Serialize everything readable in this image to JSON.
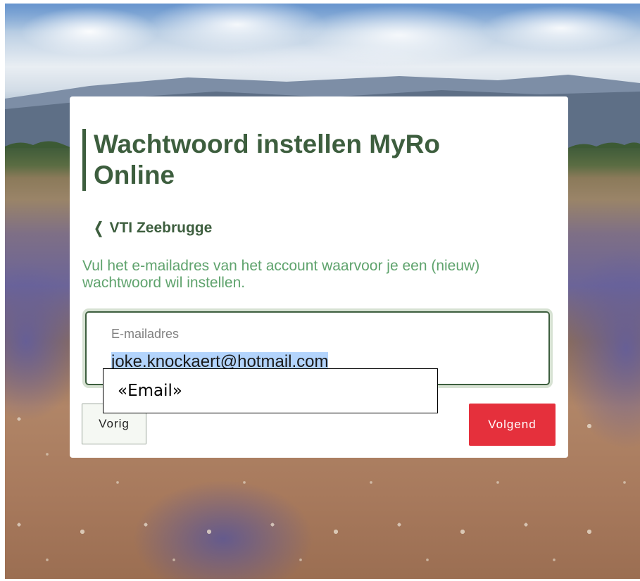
{
  "card": {
    "title": "Wachtwoord instellen MyRo Online",
    "back_link": {
      "icon": "chevron-left-icon",
      "label": "VTI Zeebrugge"
    },
    "description": "Vul het e-mailadres van het account waarvoor je een (nieuw) wachtwoord wil instellen.",
    "email_field": {
      "label": "E-mailadres",
      "value": "joke.knockaert@hotmail.com"
    },
    "buttons": {
      "previous_label": "Vorig",
      "next_label": "Volgend"
    }
  },
  "overlay": {
    "label": "«Email»"
  },
  "colors": {
    "heading": "#3d5e3e",
    "description": "#5fa36d",
    "next_button": "#e5303c",
    "selection": "#b3d4fc"
  }
}
